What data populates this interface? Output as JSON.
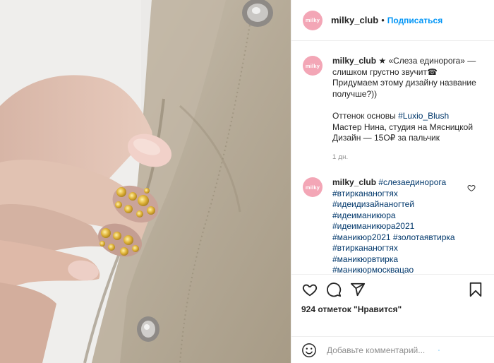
{
  "header": {
    "avatar_text": "milky",
    "username": "milky_club",
    "separator": "•",
    "follow_label": "Подписаться"
  },
  "caption": {
    "username": "milky_club",
    "lines": [
      "★ «Слеза единорога» —",
      "слишком грустно звучит☎",
      "Придумаем этому дизайну название",
      "получше?))"
    ],
    "shade_prefix": "Оттенок основы ",
    "shade_tag": "#Luxio_Blush",
    "master": "Мастер Нина, студия на Мясницкой",
    "price": "Дизайн — 15O₽ за пальчик",
    "time": "1 дн."
  },
  "comment": {
    "username": "milky_club",
    "tags": [
      "#слезаединорога",
      "#втиркананогтях",
      "#идеидизайнаногтей",
      "#идеиманикюра",
      "#идеиманикюра2021",
      "#маникюр2021 #золотаявтирка",
      "#втиркананогтях",
      "#маникюрвтирка",
      "#маникюрмосквацао"
    ]
  },
  "actions": {
    "likes_text": "924 отметок \"Нравится\""
  },
  "add_comment": {
    "placeholder": "Добавьте комментарий...",
    "post_label": "·"
  },
  "icons": {
    "like": "heart-icon",
    "comment": "comment-icon",
    "share": "paper-plane-icon",
    "save": "bookmark-icon",
    "emoji": "smiley-icon",
    "comment_like": "heart-icon"
  },
  "colors": {
    "link": "#0095f6",
    "hashtag": "#00376b",
    "avatar_bg": "#f3a6b6",
    "muted": "#8e8e8e"
  }
}
